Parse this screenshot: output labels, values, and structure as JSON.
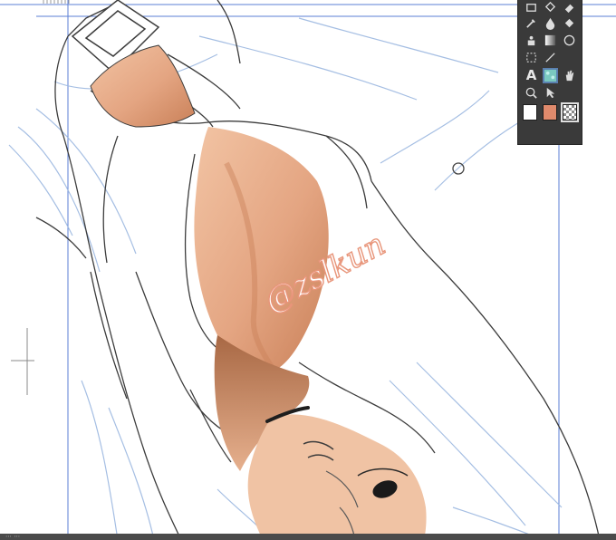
{
  "canvas": {
    "signature_text": "@zslkun",
    "skin_color": "#e4a582",
    "skin_shadow": "#c77d56",
    "line_color": "#3c3c3c",
    "sketch_color": "#9cb8e0",
    "guide_color": "#5b7fd6"
  },
  "toolbox": {
    "tools": [
      {
        "name": "layer-move-icon"
      },
      {
        "name": "lasso-icon"
      },
      {
        "name": "eraser-icon"
      },
      {
        "name": "eyedropper-icon"
      },
      {
        "name": "ink-drop-icon"
      },
      {
        "name": "fill-bucket-icon"
      },
      {
        "name": "airbrush-icon"
      },
      {
        "name": "gradient-icon"
      },
      {
        "name": "ellipse-icon"
      },
      {
        "name": "selection-dots-icon"
      },
      {
        "name": "line-icon"
      },
      {
        "name": "text-icon",
        "label": "A"
      },
      {
        "name": "pattern-brush-icon"
      },
      {
        "name": "hand-icon"
      },
      {
        "name": "zoom-icon"
      },
      {
        "name": "object-select-icon"
      }
    ],
    "colors": {
      "main": "#ffffff",
      "sub": "#e08a6c",
      "transparent": "transparent-checker"
    }
  },
  "statusbar": {
    "text": "⋯ ⋯"
  }
}
